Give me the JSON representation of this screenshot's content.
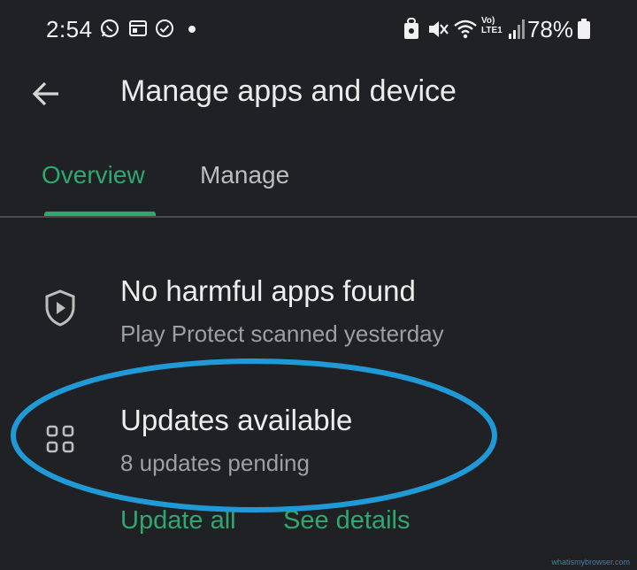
{
  "status_bar": {
    "time": "2:54",
    "battery": "78%",
    "network_label_top": "Vo)",
    "network_label_bottom": "LTE1"
  },
  "app_bar": {
    "title": "Manage apps and device",
    "back_icon": "arrow-back-icon"
  },
  "tabs": [
    {
      "label": "Overview",
      "selected": true
    },
    {
      "label": "Manage",
      "selected": false
    }
  ],
  "protect": {
    "icon": "play-protect-shield-icon",
    "title": "No harmful apps found",
    "subtitle": "Play Protect scanned yesterday"
  },
  "updates": {
    "icon": "apps-grid-icon",
    "title": "Updates available",
    "subtitle": "8 updates pending",
    "update_all_label": "Update all",
    "see_details_label": "See details"
  },
  "watermark": "whatismybrowser.com",
  "colors": {
    "background": "#202124",
    "accent_green": "#2fa870",
    "annotation_blue": "#1f9ad6"
  }
}
